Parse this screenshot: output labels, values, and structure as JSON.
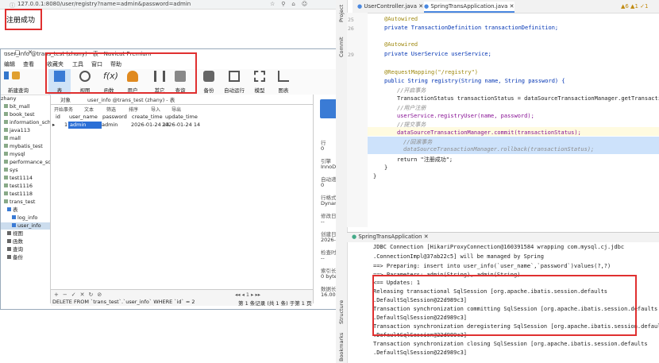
{
  "browser": {
    "url": "127.0.0.1:8080/user/registry?name=admin&password=admin",
    "page_message": "注册成功"
  },
  "navicat": {
    "window_title": "user_info @trans_test (zhany) - 表 - Navicat Premium",
    "menu": [
      "编辑",
      "查看",
      "收藏夹",
      "工具",
      "窗口",
      "帮助"
    ],
    "menu_extra": "新建查询",
    "login": "登录",
    "toolbar": [
      {
        "label": "表",
        "icon": "table-icon"
      },
      {
        "label": "视图",
        "icon": "view-icon"
      },
      {
        "label": "函数",
        "icon": "function-icon"
      },
      {
        "label": "用户",
        "icon": "user-icon"
      },
      {
        "label": "其它",
        "icon": "tools-icon"
      },
      {
        "label": "查询",
        "icon": "query-icon"
      },
      {
        "label": "备份",
        "icon": "backup-icon"
      },
      {
        "label": "自动运行",
        "icon": "calendar-icon"
      },
      {
        "label": "模型",
        "icon": "model-icon"
      },
      {
        "label": "图表",
        "icon": "chart-icon"
      }
    ],
    "tree": [
      "zhany",
      "bit_mall",
      "book_test",
      "information_schema",
      "java113",
      "mall",
      "mybatis_test",
      "mysql",
      "performance_schema",
      "sys",
      "test1114",
      "test1116",
      "test1118",
      "trans_test",
      "表",
      "log_info",
      "user_info",
      "视图",
      "函数",
      "查询",
      "备份"
    ],
    "tabs": [
      "对象",
      "user_info @trans_test (zhany) - 表"
    ],
    "subtoolbar": [
      "开始事务",
      "文本",
      "筛选",
      "排序",
      "导入",
      "导出"
    ],
    "columns": [
      "id",
      "user_name",
      "password",
      "create_time",
      "update_time"
    ],
    "row": {
      "marker": "▸",
      "id": "1",
      "user_name": "admin",
      "password": "admin",
      "create_time": "2026-01-24 14",
      "update_time": "2026-01-24 14"
    },
    "info": {
      "row_label": "行",
      "row_value": "0",
      "engine_label": "引擎",
      "engine_value": "InnoDB",
      "auto_inc_label": "自动递增",
      "auto_inc_value": "0",
      "row_format_label": "行格式",
      "row_format_value": "Dynamic",
      "modified_label": "修改日期",
      "modified_value": "--",
      "created_label": "创建日期",
      "created_value": "2026-01-2",
      "checked_label": "检查时间",
      "checked_value": "--",
      "index_len_label": "索引长度",
      "index_len_value": "0 bytes (0)",
      "data_len_label": "数据长度",
      "data_len_value": "16.00 KB ("
    },
    "bottom_sql": "DELETE FROM `trans_test`.`user_info` WHERE `id` = 2",
    "bottom_record": "第 1 条记录 (共 1 条) 于第 1 页",
    "bottom_page": "1"
  },
  "ide": {
    "strip_label": "Project",
    "strip_label2": "Commit",
    "strip_label3": "Structure",
    "strip_label4": "Bookmarks",
    "tabs": [
      "UserController.java",
      "SpringTransApplication.java"
    ],
    "inspections": "▲6  ▲1  ✓1",
    "lines": [
      {
        "n": "25",
        "text": "@Autowired"
      },
      {
        "n": "26",
        "text": "private TransactionDefinition transactionDefinition;"
      },
      {
        "n": "27",
        "text": ""
      },
      {
        "n": "28",
        "text": "@Autowired"
      },
      {
        "n": "29",
        "text": "private UserService userService;"
      },
      {
        "n": "30",
        "text": ""
      },
      {
        "n": "31",
        "text": "@RequestMapping(\"/registry\")"
      },
      {
        "n": "32",
        "text": "public String registry(String name, String password) {"
      },
      {
        "n": "33",
        "text": "//开启事务"
      },
      {
        "n": "34",
        "text": "TransactionStatus transactionStatus = dataSourceTransactionManager.getTransaction(t"
      },
      {
        "n": "35",
        "text": "//用户注册"
      },
      {
        "n": "36",
        "text": "userService.registryUser(name, password);"
      },
      {
        "n": "37",
        "text": "//提交事务"
      },
      {
        "n": "38",
        "text": "dataSourceTransactionManager.commit(transactionStatus);"
      },
      {
        "n": "39",
        "text": "//回滚事务"
      },
      {
        "n": "40",
        "text": "dataSourceTransactionManager.rollback(transactionStatus);"
      },
      {
        "n": "41",
        "text": "return \"注册成功\";"
      },
      {
        "n": "42",
        "text": "}"
      },
      {
        "n": "43",
        "text": "}"
      }
    ],
    "console_tab": "SpringTransApplication",
    "console": [
      "JDBC Connection [HikariProxyConnection@160391584 wrapping com.mysql.cj.jdbc",
      ".ConnectionImpl@37ab22c5] will be managed by Spring",
      "==>  Preparing: insert into user_info(`user_name`,`password`)values(?,?)",
      "==> Parameters: admin(String), admin(String)",
      "<==    Updates: 1",
      "Releasing transactional SqlSession [org.apache.ibatis.session.defaults",
      ".DefaultSqlSession@22d989c3]",
      "Transaction synchronization committing SqlSession [org.apache.ibatis.session.defaults",
      ".DefaultSqlSession@22d989c3]",
      "Transaction synchronization deregistering SqlSession [org.apache.ibatis.session.defaults",
      ".DefaultSqlSession@22d989c3]",
      "Transaction synchronization closing SqlSession [org.apache.ibatis.session.defaults",
      ".DefaultSqlSession@22d989c3]"
    ]
  }
}
